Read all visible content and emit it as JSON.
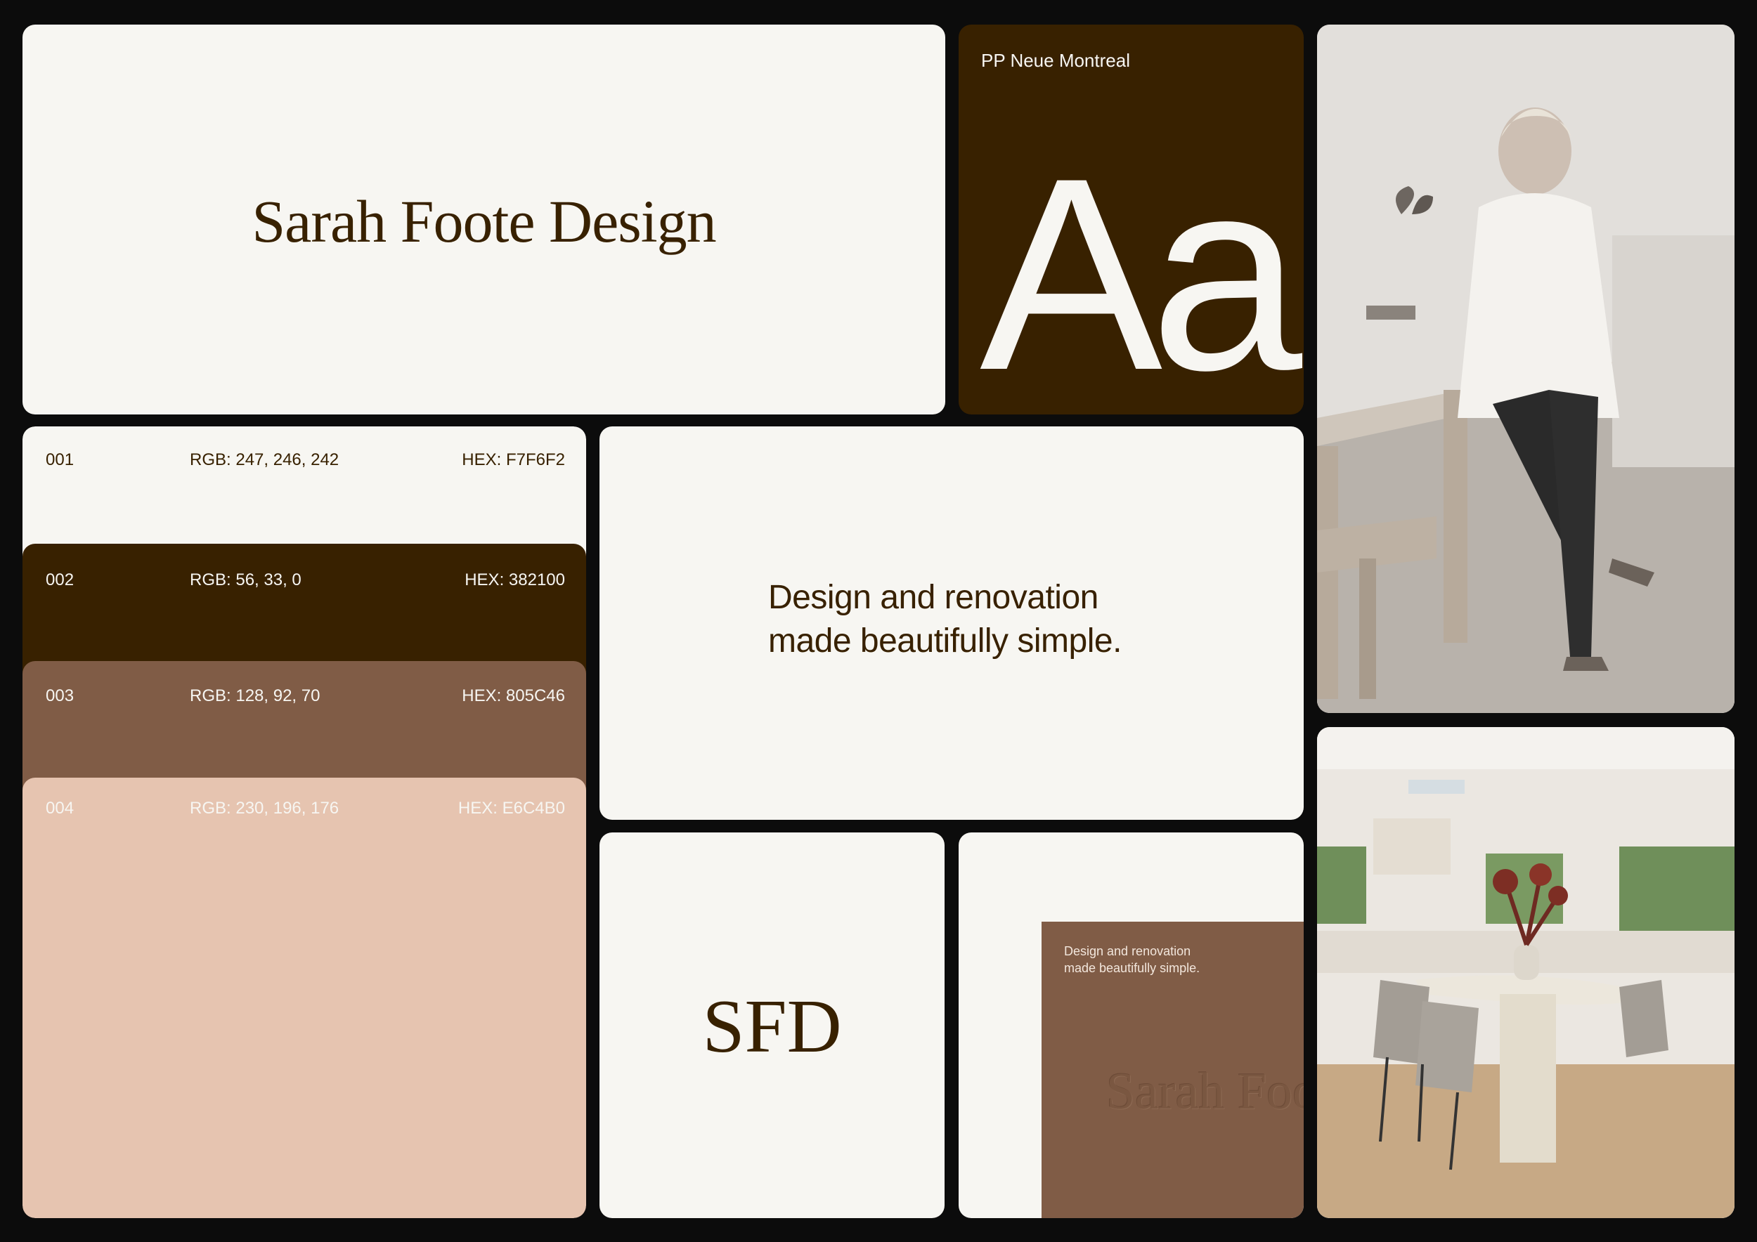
{
  "logo": {
    "wordmark": "Sarah Foote Design"
  },
  "typeface": {
    "font_name": "PP Neue Montreal",
    "specimen": "Aa"
  },
  "palette": [
    {
      "id": "001",
      "rgb": "RGB: 247, 246, 242",
      "hex": "HEX: F7F6F2",
      "color": "#F7F6F2"
    },
    {
      "id": "002",
      "rgb": "RGB: 56, 33, 0",
      "hex": "HEX: 382100",
      "color": "#382100"
    },
    {
      "id": "003",
      "rgb": "RGB: 128, 92, 70",
      "hex": "HEX: 805C46",
      "color": "#805C46"
    },
    {
      "id": "004",
      "rgb": "RGB: 230, 196, 176",
      "hex": "HEX: E6C4B0",
      "color": "#E6C4B0"
    }
  ],
  "tagline": {
    "line1": "Design and renovation",
    "line2": "made beautifully simple."
  },
  "monogram": "SFD",
  "stationery": {
    "line1": "Design and renovation",
    "line2": "made beautifully simple.",
    "emboss": "Sarah Foote"
  }
}
